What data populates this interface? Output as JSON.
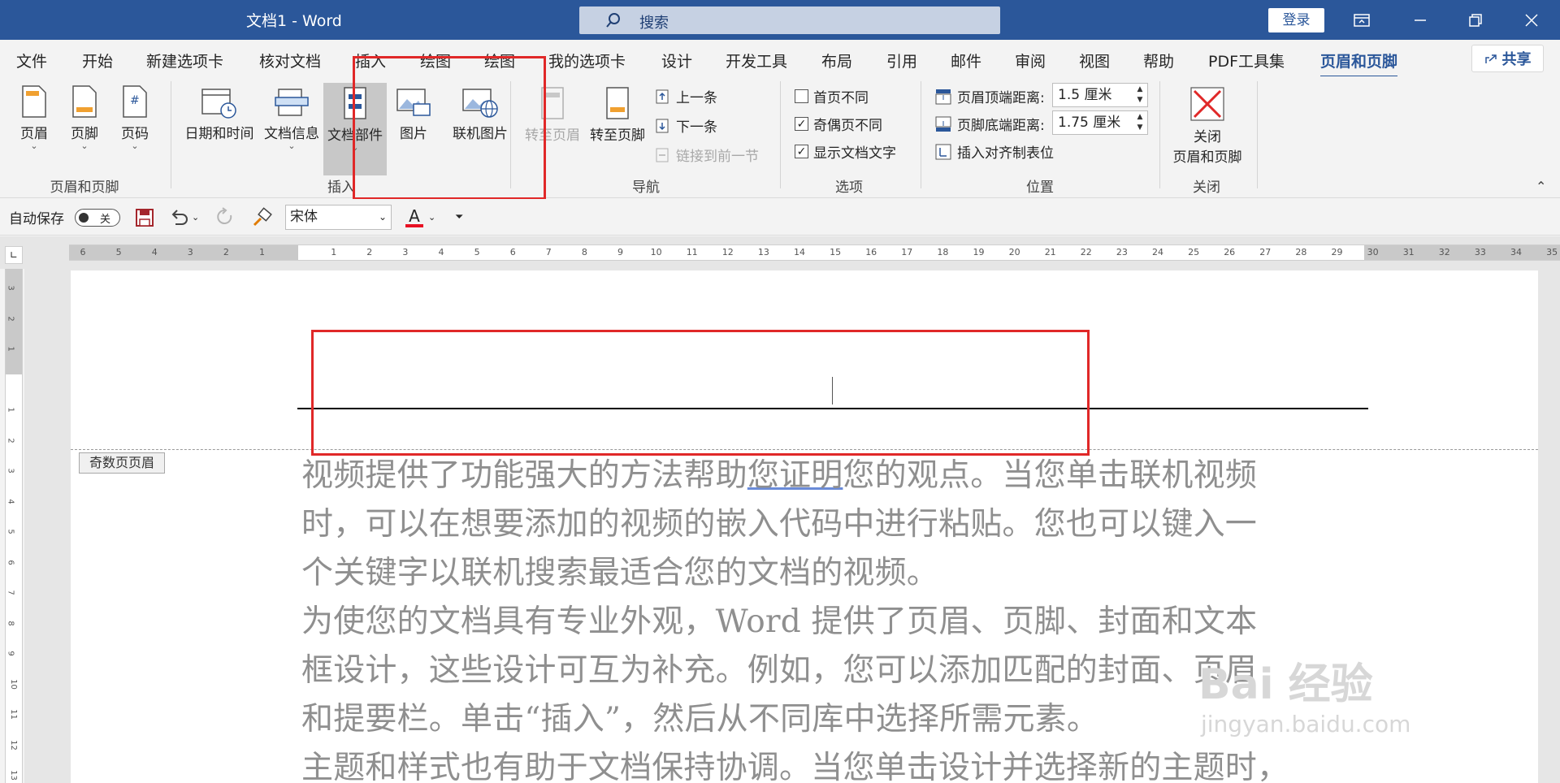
{
  "titlebar": {
    "title": "文档1 - Word",
    "search_placeholder": "搜索",
    "login": "登录",
    "bg": "#2b579a"
  },
  "menu": {
    "tabs": [
      "文件",
      "开始",
      "新建选项卡",
      "核对文档",
      "插入",
      "绘图",
      "绘图",
      "我的选项卡",
      "设计",
      "开发工具",
      "布局",
      "引用",
      "邮件",
      "审阅",
      "视图",
      "帮助",
      "PDF工具集",
      "页眉和页脚"
    ],
    "active_index": 17,
    "share": "共享"
  },
  "ribbon": {
    "group_header_footer": {
      "label": "页眉和页脚",
      "header": "页眉",
      "footer": "页脚",
      "page_number": "页码"
    },
    "group_insert": {
      "label": "插入",
      "datetime": "日期和时间",
      "docinfo": "文档信息",
      "quickparts": "文档部件",
      "picture": "图片",
      "online_picture": "联机图片"
    },
    "group_nav": {
      "label": "导航",
      "goto_header": "转至页眉",
      "goto_footer": "转至页脚",
      "prev": "上一条",
      "next": "下一条",
      "link_prev": "链接到前一节"
    },
    "group_options": {
      "label": "选项",
      "diff_first": "首页不同",
      "diff_odd_even": "奇偶页不同",
      "show_doc_text": "显示文档文字",
      "diff_first_checked": false,
      "diff_odd_even_checked": true,
      "show_doc_text_checked": true
    },
    "group_position": {
      "label": "位置",
      "header_top": "页眉顶端距离:",
      "header_top_value": "1.5 厘米",
      "footer_bottom": "页脚底端距离:",
      "footer_bottom_value": "1.75 厘米",
      "insert_align_tab": "插入对齐制表位"
    },
    "group_close": {
      "label": "关闭",
      "close_line1": "关闭",
      "close_line2": "页眉和页脚"
    }
  },
  "qat": {
    "autosave": "自动保存",
    "toggle_state": "关",
    "font": "宋体",
    "font_color_letter": "A",
    "font_color": "#e81123"
  },
  "ruler": {
    "h_numbers": [
      "6",
      "5",
      "4",
      "3",
      "2",
      "1",
      "",
      "1",
      "2",
      "3",
      "4",
      "5",
      "6",
      "7",
      "8",
      "9",
      "10",
      "11",
      "12",
      "13",
      "14",
      "15",
      "16",
      "17",
      "18",
      "19",
      "20",
      "21",
      "22",
      "23",
      "24",
      "25",
      "26",
      "27",
      "28",
      "29",
      "30",
      "31",
      "32",
      "33",
      "34",
      "35"
    ],
    "v_numbers": [
      "3",
      "2",
      "1",
      "",
      "1",
      "2",
      "3",
      "4",
      "5",
      "6",
      "7",
      "8",
      "9",
      "10",
      "11",
      "12",
      "13"
    ]
  },
  "document": {
    "header_tag": "奇数页页眉",
    "lines": [
      [
        "视频提供了功能强大的方法帮助",
        "您证明",
        "您的观点。当您单击联机视频"
      ],
      [
        "时，可以在想要添加的视频的嵌入代码中进行粘贴。您也可以键入一"
      ],
      [
        "个关键字以联机搜索最适合您的文档的视频。"
      ],
      [
        "为使您的文档具有专业外观，Word 提供了页眉、页脚、封面和文本"
      ],
      [
        "框设计，这些设计可互为补充。例如，您可以添加匹配的封面、页眉"
      ],
      [
        "和提要栏。单击“插入”，然后从不同库中选择所需元素。"
      ],
      [
        "主题和样式也有助于文档保持协调。当您单击设计并选择新的主题时，"
      ]
    ]
  },
  "watermark": {
    "line1": "Bai 经验",
    "line2": "jingyan.baidu.com"
  },
  "colors": {
    "accent": "#2b579a",
    "highlight": "#e02828"
  }
}
